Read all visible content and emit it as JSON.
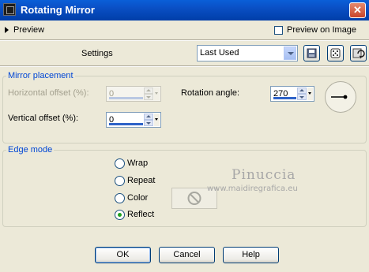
{
  "window": {
    "title": "Rotating Mirror",
    "close_glyph": "✕"
  },
  "preview": {
    "label": "Preview",
    "on_image_label": "Preview on Image",
    "on_image_checked": false
  },
  "settings": {
    "label": "Settings",
    "preset_value": "Last Used"
  },
  "mirror_placement": {
    "legend": "Mirror placement",
    "horizontal_label": "Horizontal offset (%):",
    "horizontal_value": "0",
    "vertical_label": "Vertical offset (%):",
    "vertical_value": "0",
    "rotation_label": "Rotation angle:",
    "rotation_value": "270"
  },
  "edge_mode": {
    "legend": "Edge mode",
    "options": [
      "Wrap",
      "Repeat",
      "Color",
      "Reflect"
    ],
    "selected": "Reflect"
  },
  "watermark": {
    "name": "Pinuccia",
    "url": "www.maidiregrafica.eu"
  },
  "buttons": {
    "ok": "OK",
    "cancel": "Cancel",
    "help": "Help"
  },
  "colors": {
    "accent": "#0046d5",
    "title_bar": "#0a4fc4",
    "background": "#ece9d8"
  }
}
